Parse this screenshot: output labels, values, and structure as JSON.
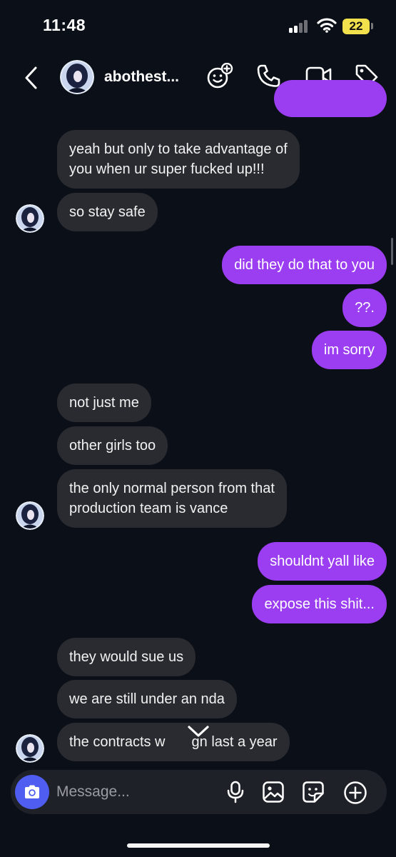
{
  "status_bar": {
    "time": "11:48",
    "battery": "22"
  },
  "header": {
    "username": "abothest...",
    "icons": [
      "back-chevron-icon",
      "avatar",
      "effects-icon",
      "phone-icon",
      "video-camera-icon",
      "tag-icon"
    ]
  },
  "messages": [
    {
      "from": "me",
      "text": ""
    },
    {
      "from": "them",
      "text": "yeah but only to take advantage of"
    },
    {
      "from": "them",
      "text": "you when ur super fucked up!!!"
    },
    {
      "from": "them",
      "text": "so stay safe"
    },
    {
      "from": "me",
      "text": "did they do that to you"
    },
    {
      "from": "me",
      "text": "??."
    },
    {
      "from": "me",
      "text": "im sorry"
    },
    {
      "from": "them",
      "text": "not just me"
    },
    {
      "from": "them",
      "text": "other girls too"
    },
    {
      "from": "them",
      "text": "the only normal person from that"
    },
    {
      "from": "them",
      "text": "production team is vance"
    },
    {
      "from": "me",
      "text": "shouldnt yall like"
    },
    {
      "from": "me",
      "text": "expose this shit..."
    },
    {
      "from": "them",
      "text": "they would sue us"
    },
    {
      "from": "them",
      "text": "we are still under an nda"
    },
    {
      "from": "them",
      "text": "the contracts w"
    },
    {
      "from": "them",
      "text": "gn last a year"
    }
  ],
  "composer": {
    "placeholder": "Message...",
    "icons": [
      "camera-icon",
      "microphone-icon",
      "image-icon",
      "sticker-icon",
      "plus-icon"
    ]
  },
  "colors": {
    "background": "#0b0f17",
    "incoming_bubble": "#2a2b30",
    "outgoing_bubble": "#9b3df0",
    "camera_button": "#4f5ef0",
    "battery": "#f2e14c"
  }
}
